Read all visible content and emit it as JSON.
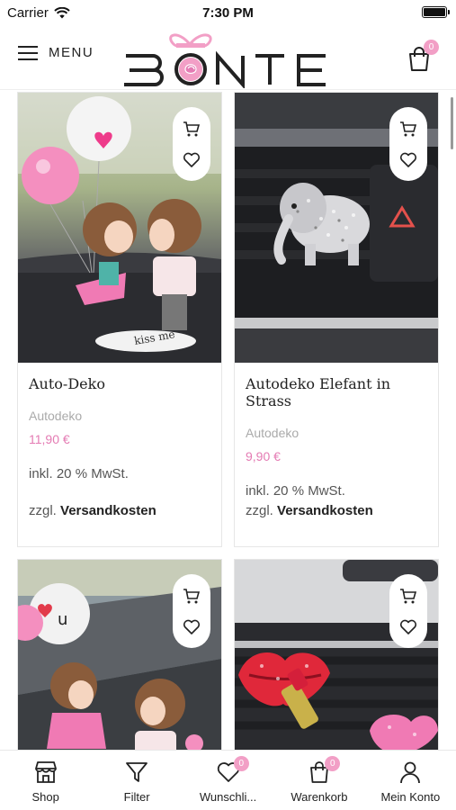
{
  "status_bar": {
    "carrier": "Carrier",
    "time": "7:30 PM"
  },
  "header": {
    "menu_label": "MENU",
    "logo_text": "BONTE",
    "cart_count": "0"
  },
  "products": [
    {
      "title": "Auto-Deko",
      "category": "Autodeko",
      "price": "11,90 €",
      "tax": "inkl. 20 % MwSt.",
      "shipping_prefix": "zzgl.",
      "shipping_link": "Versandkosten",
      "image": "kissing-couple-figurine"
    },
    {
      "title": "Autodeko Elefant in Strass",
      "category": "Autodeko",
      "price": "9,90 €",
      "tax": "inkl. 20 % MwSt.",
      "shipping_prefix": "zzgl.",
      "shipping_link": "Versandkosten",
      "image": "rhinestone-elephant-vent-clip"
    },
    {
      "title": "",
      "category": "",
      "price": "",
      "tax": "",
      "shipping_prefix": "",
      "shipping_link": "",
      "image": "balloon-couple-figurine"
    },
    {
      "title": "",
      "category": "",
      "price": "",
      "tax": "",
      "shipping_prefix": "",
      "shipping_link": "",
      "image": "rhinestone-lips-vent-clip"
    }
  ],
  "tabs": [
    {
      "label": "Shop",
      "icon": "shop-icon"
    },
    {
      "label": "Filter",
      "icon": "filter-icon"
    },
    {
      "label": "Wunschli...",
      "icon": "heart-icon",
      "badge": "0"
    },
    {
      "label": "Warenkorb",
      "icon": "bag-icon",
      "badge": "0"
    },
    {
      "label": "Mein Konto",
      "icon": "user-icon"
    }
  ],
  "colors": {
    "accent_pink": "#e47bb3",
    "badge_pink": "#f29fc6",
    "text": "#222222",
    "muted": "#aaaaaa"
  }
}
